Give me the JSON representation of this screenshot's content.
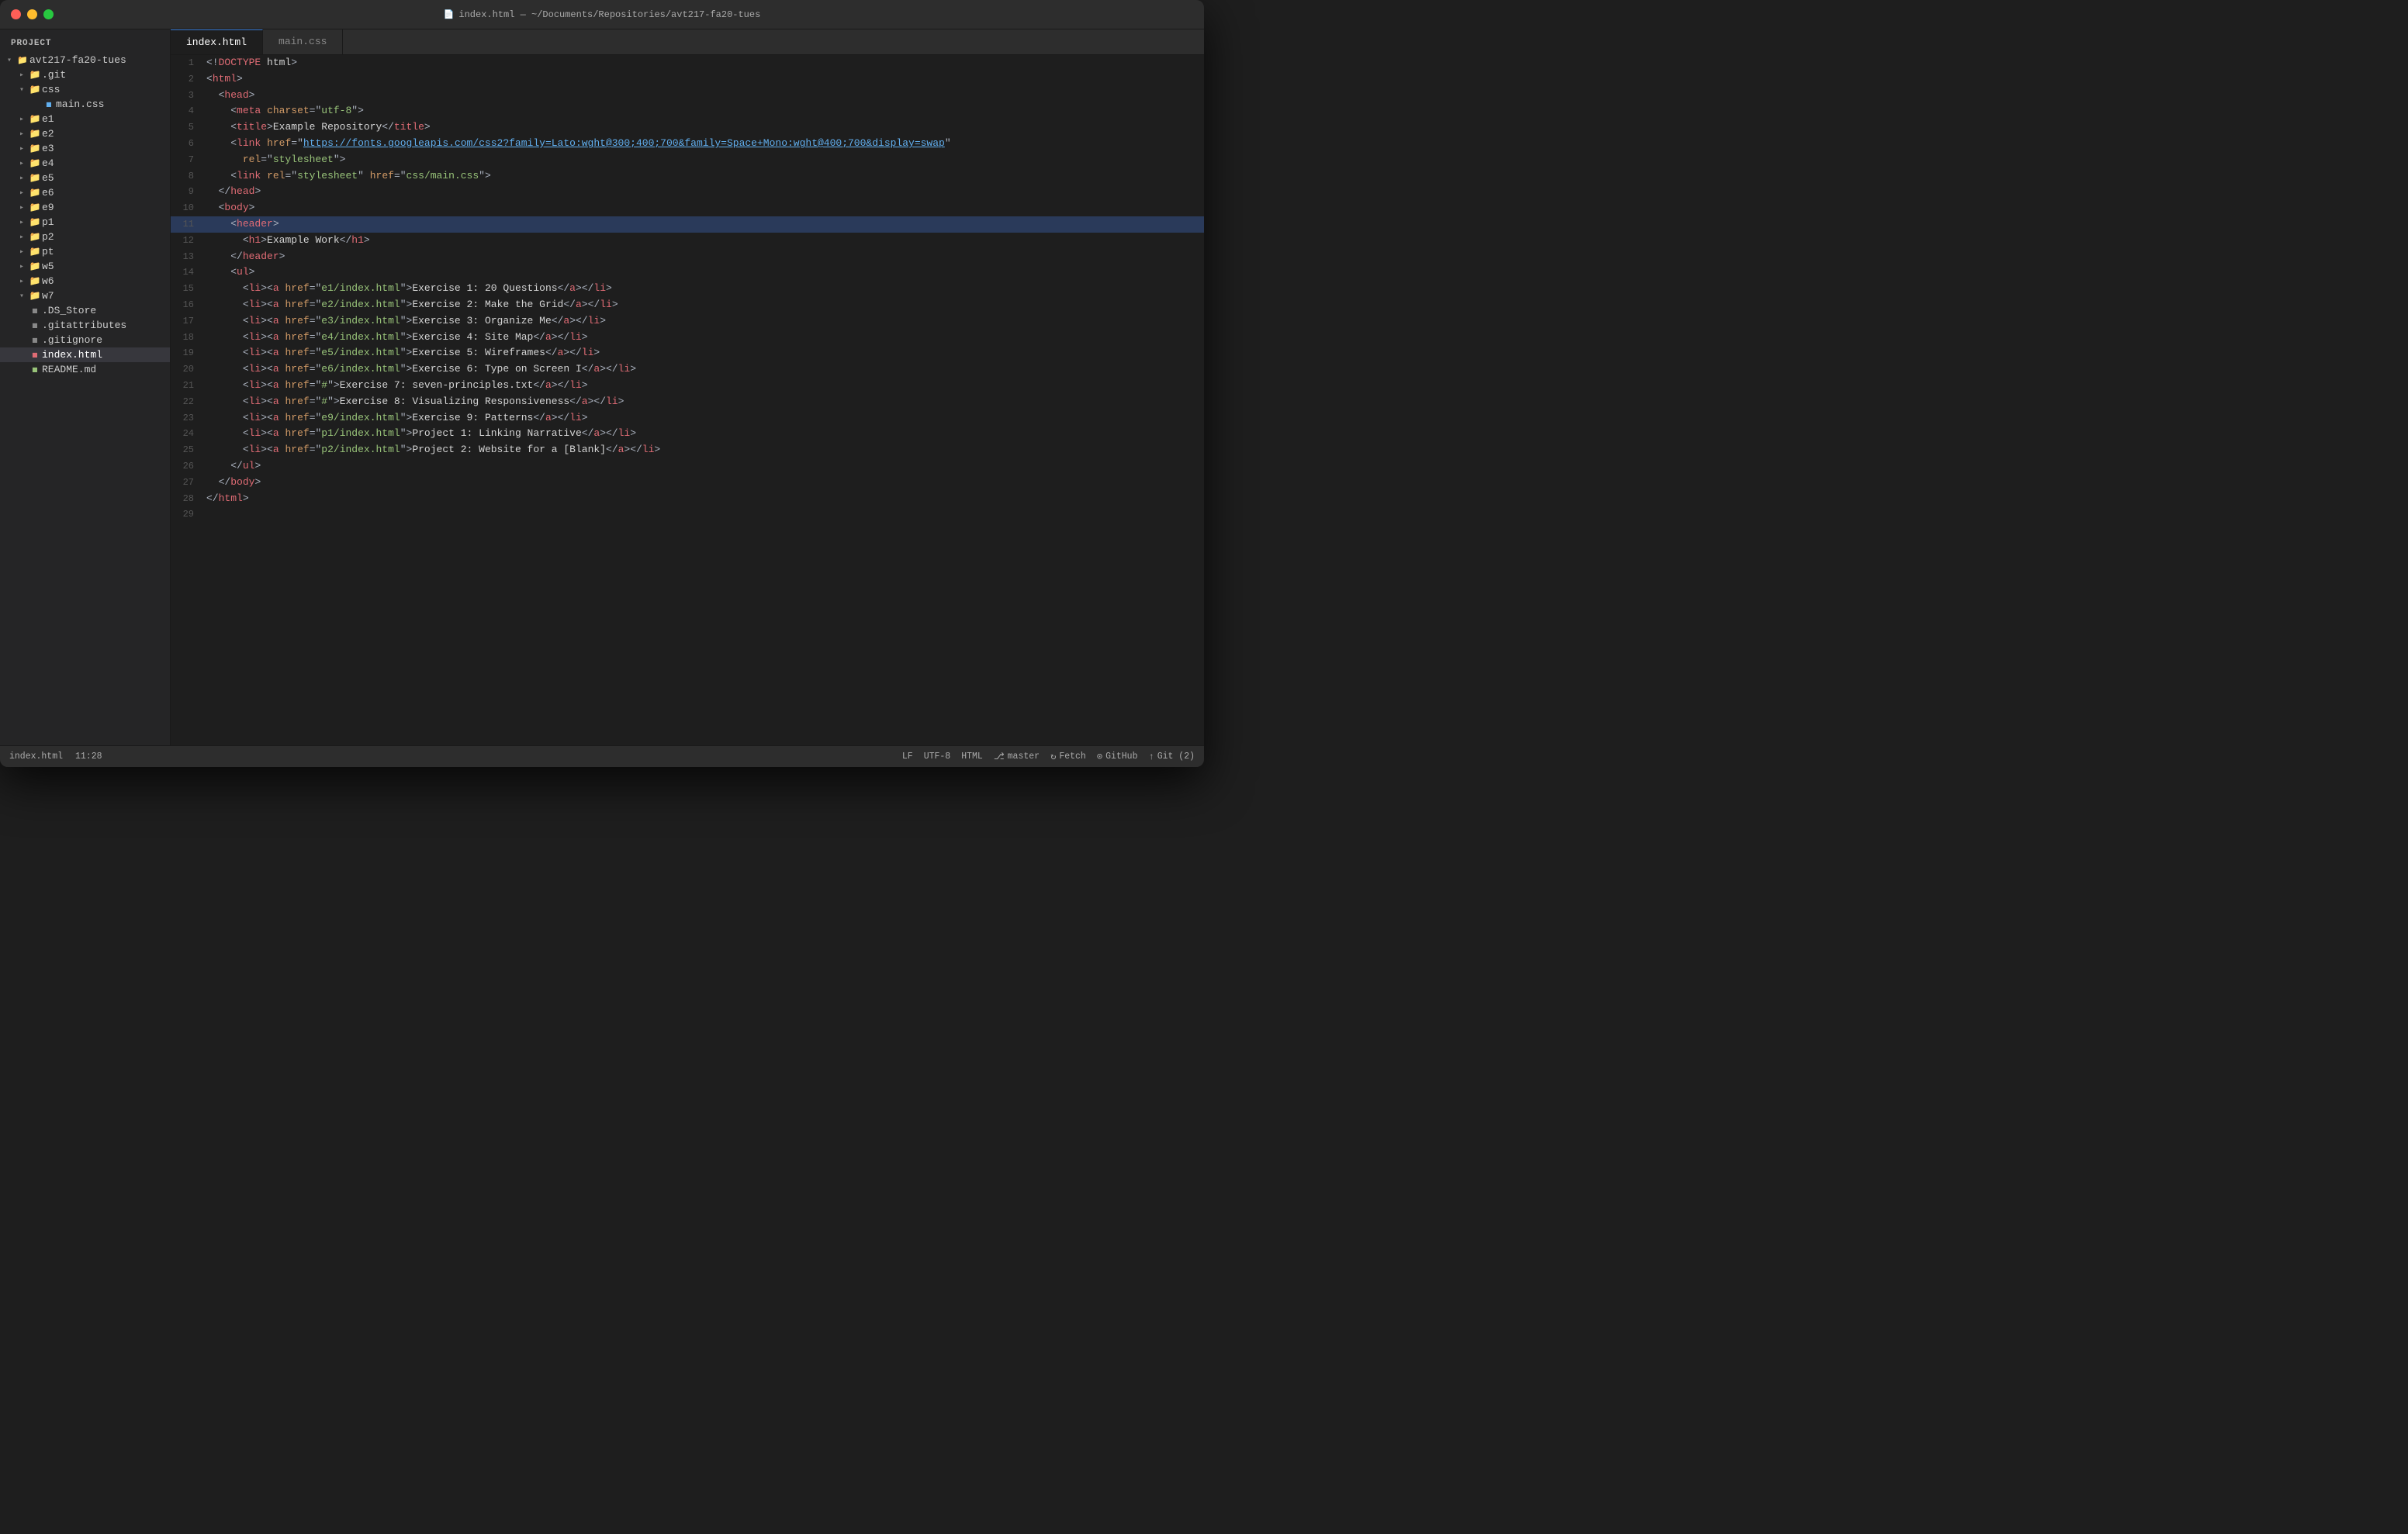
{
  "window": {
    "title": "index.html — ~/Documents/Repositories/avt217-fa20-tues"
  },
  "titlebar": {
    "buttons": {
      "close_label": "close",
      "min_label": "minimize",
      "max_label": "maximize"
    },
    "title": "index.html — ~/Documents/Repositories/avt217-fa20-tues",
    "file_icon": "📄"
  },
  "sidebar": {
    "header": "Project",
    "root": "avt217-fa20-tues",
    "items": [
      {
        "id": "git",
        "name": ".git",
        "type": "folder",
        "level": 1,
        "expanded": false
      },
      {
        "id": "css",
        "name": "css",
        "type": "folder",
        "level": 1,
        "expanded": true
      },
      {
        "id": "main.css",
        "name": "main.css",
        "type": "css",
        "level": 2,
        "expanded": false
      },
      {
        "id": "e1",
        "name": "e1",
        "type": "folder",
        "level": 1,
        "expanded": false
      },
      {
        "id": "e2",
        "name": "e2",
        "type": "folder",
        "level": 1,
        "expanded": false
      },
      {
        "id": "e3",
        "name": "e3",
        "type": "folder",
        "level": 1,
        "expanded": false
      },
      {
        "id": "e4",
        "name": "e4",
        "type": "folder",
        "level": 1,
        "expanded": false
      },
      {
        "id": "e5",
        "name": "e5",
        "type": "folder",
        "level": 1,
        "expanded": false
      },
      {
        "id": "e6",
        "name": "e6",
        "type": "folder",
        "level": 1,
        "expanded": false
      },
      {
        "id": "e9",
        "name": "e9",
        "type": "folder",
        "level": 1,
        "expanded": false
      },
      {
        "id": "p1",
        "name": "p1",
        "type": "folder",
        "level": 1,
        "expanded": false
      },
      {
        "id": "p2",
        "name": "p2",
        "type": "folder",
        "level": 1,
        "expanded": false
      },
      {
        "id": "pt",
        "name": "pt",
        "type": "folder",
        "level": 1,
        "expanded": false
      },
      {
        "id": "w5",
        "name": "w5",
        "type": "folder",
        "level": 1,
        "expanded": false
      },
      {
        "id": "w6",
        "name": "w6",
        "type": "folder",
        "level": 1,
        "expanded": false
      },
      {
        "id": "w7",
        "name": "w7",
        "type": "folder",
        "level": 1,
        "expanded": true
      },
      {
        "id": ".ds_store",
        "name": ".DS_Store",
        "type": "file",
        "level": 1,
        "expanded": false
      },
      {
        "id": ".gitattributes",
        "name": ".gitattributes",
        "type": "file",
        "level": 1,
        "expanded": false
      },
      {
        "id": ".gitignore",
        "name": ".gitignore",
        "type": "file",
        "level": 1,
        "expanded": false
      },
      {
        "id": "index.html",
        "name": "index.html",
        "type": "html",
        "level": 1,
        "expanded": false,
        "active": true
      },
      {
        "id": "readme",
        "name": "README.md",
        "type": "md",
        "level": 1,
        "expanded": false
      }
    ]
  },
  "tabs": [
    {
      "id": "index",
      "label": "index.html",
      "active": true
    },
    {
      "id": "maincss",
      "label": "main.css",
      "active": false
    }
  ],
  "code_lines": [
    {
      "num": 1,
      "content": "<!DOCTYPE html>"
    },
    {
      "num": 2,
      "content": "<html>"
    },
    {
      "num": 3,
      "content": "  <head>"
    },
    {
      "num": 4,
      "content": "    <meta charset=\"utf-8\">"
    },
    {
      "num": 5,
      "content": "    <title>Example Repository</title>"
    },
    {
      "num": 6,
      "content": "    <link href=\"https://fonts.googleapis.com/css2?family=Lato:wght@300;400;700&family=Space+Mono:wght@400;700&display=swap\""
    },
    {
      "num": 7,
      "content": "      rel=\"stylesheet\">"
    },
    {
      "num": 8,
      "content": "    <link rel=\"stylesheet\" href=\"css/main.css\">"
    },
    {
      "num": 9,
      "content": "  </head>"
    },
    {
      "num": 10,
      "content": "  <body>"
    },
    {
      "num": 11,
      "content": "    <header>"
    },
    {
      "num": 12,
      "content": "      <h1>Example Work</h1>"
    },
    {
      "num": 13,
      "content": "    </header>"
    },
    {
      "num": 14,
      "content": "    <ul>"
    },
    {
      "num": 15,
      "content": "      <li><a href=\"e1/index.html\">Exercise 1: 20 Questions</a></li>"
    },
    {
      "num": 16,
      "content": "      <li><a href=\"e2/index.html\">Exercise 2: Make the Grid</a></li>"
    },
    {
      "num": 17,
      "content": "      <li><a href=\"e3/index.html\">Exercise 3: Organize Me</a></li>"
    },
    {
      "num": 18,
      "content": "      <li><a href=\"e4/index.html\">Exercise 4: Site Map</a></li>"
    },
    {
      "num": 19,
      "content": "      <li><a href=\"e5/index.html\">Exercise 5: Wireframes</a></li>"
    },
    {
      "num": 20,
      "content": "      <li><a href=\"e6/index.html\">Exercise 6: Type on Screen I</a></li>"
    },
    {
      "num": 21,
      "content": "      <li><a href=\"#\">Exercise 7: seven-principles.txt</a></li>"
    },
    {
      "num": 22,
      "content": "      <li><a href=\"#\">Exercise 8: Visualizing Responsiveness</a></li>"
    },
    {
      "num": 23,
      "content": "      <li><a href=\"e9/index.html\">Exercise 9: Patterns</a></li>"
    },
    {
      "num": 24,
      "content": "      <li><a href=\"p1/index.html\">Project 1: Linking Narrative</a></li>"
    },
    {
      "num": 25,
      "content": "      <li><a href=\"p2/index.html\">Project 2: Website for a [Blank]</a></li>"
    },
    {
      "num": 26,
      "content": "    </ul>"
    },
    {
      "num": 27,
      "content": "  </body>"
    },
    {
      "num": 28,
      "content": "</html>"
    },
    {
      "num": 29,
      "content": ""
    }
  ],
  "statusbar": {
    "left": {
      "filename": "index.html",
      "position": "11:28"
    },
    "right": {
      "line_ending": "LF",
      "encoding": "UTF-8",
      "language": "HTML",
      "branch_icon": "⎇",
      "branch": "master",
      "fetch_icon": "↻",
      "fetch": "Fetch",
      "github_icon": "⊙",
      "github": "GitHub",
      "git_icon": "↑",
      "git": "Git (2)"
    }
  }
}
